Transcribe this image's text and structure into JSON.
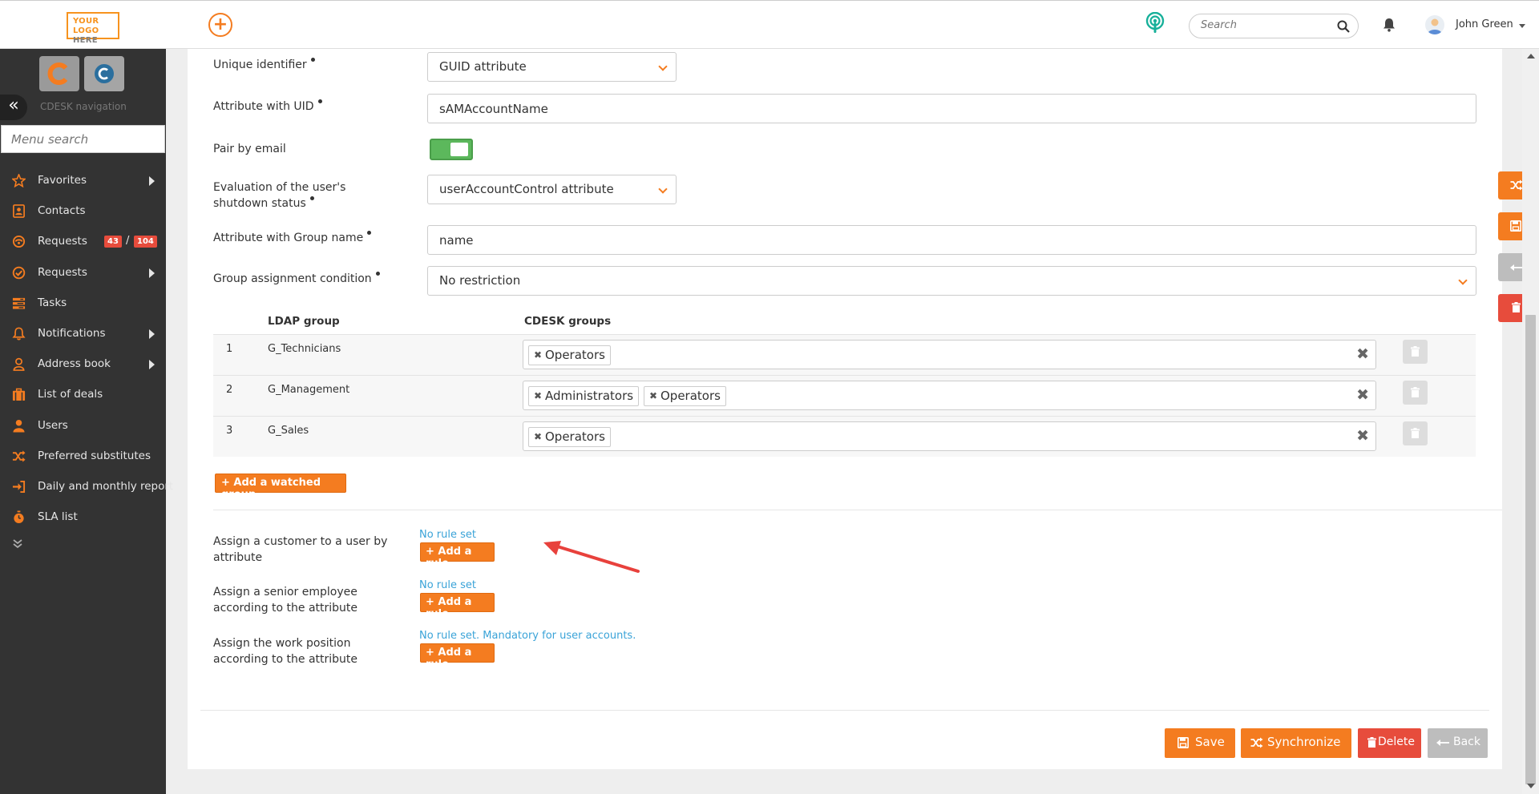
{
  "topbar": {
    "logo_line1": "YOUR LOGO",
    "logo_line2": "HERE",
    "search_placeholder": "Search",
    "user_name": "John Green",
    "icons": [
      "plus-icon",
      "podcast-icon",
      "search-icon",
      "bell-icon",
      "avatar",
      "chevron-down-icon"
    ]
  },
  "sidebar": {
    "nav_title": "CDESK navigation",
    "menu_search_placeholder": "Menu search",
    "items": [
      {
        "label": "Favorites",
        "icon": "star-icon",
        "arrow": true
      },
      {
        "label": "Contacts",
        "icon": "contact-card-icon",
        "arrow": false
      },
      {
        "label": "Requests",
        "icon": "requests-icon",
        "arrow": false,
        "badge_open": "43",
        "badge_total": "104",
        "badge_sep": "/"
      },
      {
        "label": "Requests",
        "icon": "check-circle-icon",
        "arrow": true
      },
      {
        "label": "Tasks",
        "icon": "tasks-icon",
        "arrow": false
      },
      {
        "label": "Notifications",
        "icon": "bell-icon",
        "arrow": true
      },
      {
        "label": "Address book",
        "icon": "user-outline-icon",
        "arrow": true
      },
      {
        "label": "List of deals",
        "icon": "deals-icon",
        "arrow": false
      },
      {
        "label": "Users",
        "icon": "user-icon",
        "arrow": false
      },
      {
        "label": "Preferred substitutes",
        "icon": "shuffle-icon",
        "arrow": false
      },
      {
        "label": "Daily and monthly report",
        "icon": "sign-in-icon",
        "arrow": false
      },
      {
        "label": "SLA list",
        "icon": "stopwatch-icon",
        "arrow": false
      }
    ]
  },
  "form": {
    "unique_identifier": {
      "label": "Unique identifier",
      "value": "GUID attribute"
    },
    "attribute_uid": {
      "label": "Attribute with UID",
      "value": "sAMAccountName"
    },
    "pair_by_email": {
      "label": "Pair by email",
      "enabled": true
    },
    "shutdown_status": {
      "label_line1": "Evaluation of the user's",
      "label_line2": "shutdown status",
      "value": "userAccountControl attribute"
    },
    "group_name_attr": {
      "label": "Attribute with Group name",
      "value": "name"
    },
    "group_condition": {
      "label": "Group assignment condition",
      "value": "No restriction"
    }
  },
  "ldap_table": {
    "headers": [
      "LDAP group",
      "CDESK groups"
    ],
    "rows": [
      {
        "num": "1",
        "ldap_group": "G_Technicians",
        "cdesk_groups": [
          "Operators"
        ]
      },
      {
        "num": "2",
        "ldap_group": "G_Management",
        "cdesk_groups": [
          "Administrators",
          "Operators"
        ]
      },
      {
        "num": "3",
        "ldap_group": "G_Sales",
        "cdesk_groups": [
          "Operators"
        ]
      }
    ],
    "add_button": "+ Add a watched group"
  },
  "rules": [
    {
      "label_line1": "Assign a customer to a user by",
      "label_line2": "attribute",
      "status": "No rule set",
      "button": "+ Add a rule"
    },
    {
      "label_line1": "Assign a senior employee",
      "label_line2": "according to the attribute",
      "status": "No rule set",
      "button": "+ Add a rule"
    },
    {
      "label_line1": "Assign the work position",
      "label_line2": "according to the attribute",
      "status": "No rule set. Mandatory for user accounts.",
      "button": "+ Add a rule"
    }
  ],
  "footer": {
    "save": "Save",
    "synchronize": "Synchronize",
    "delete": "Delete",
    "back": "Back"
  },
  "colors": {
    "accent": "#f47c20",
    "danger": "#e74c3c",
    "sidebar_bg": "#333333",
    "link": "#3aa3d8",
    "toggle_on": "#5cb85c"
  }
}
